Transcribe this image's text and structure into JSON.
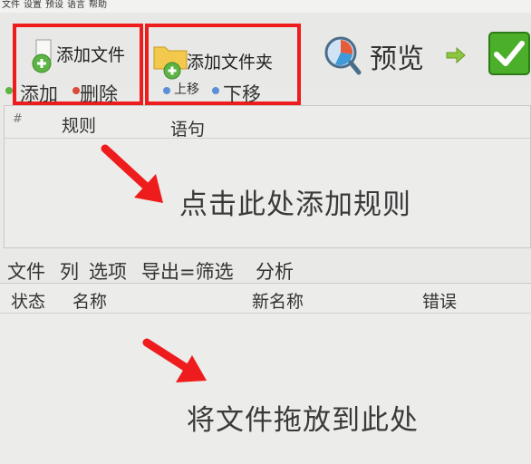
{
  "menu": [
    "文件",
    "设置",
    "预设",
    "语言",
    "帮助"
  ],
  "toolbar": {
    "add_file": "添加文件",
    "add_folder": "添加文件夹",
    "preview": "预览"
  },
  "rules_toolbar": {
    "add": "添加",
    "delete": "删除",
    "move_up": "上移",
    "move_down": "下移"
  },
  "rules_table": {
    "columns": [
      "#",
      "规则",
      "语句"
    ],
    "empty_hint": "点击此处添加规则"
  },
  "files_toolbar": {
    "items": [
      "文件",
      "列",
      "选项",
      "导出=筛选",
      "分析"
    ]
  },
  "files_table": {
    "columns": [
      "状态",
      "名称",
      "新名称",
      "错误"
    ],
    "empty_hint": "将文件拖放到此处"
  },
  "colors": {
    "highlight": "#ee1c1c",
    "add_green": "#5bb443",
    "folder_yellow": "#f2c94c",
    "check_green": "#4caf2a"
  },
  "icons": [
    "add-file-icon",
    "add-folder-icon",
    "preview-icon",
    "arrow-right-icon",
    "start-check-icon"
  ]
}
